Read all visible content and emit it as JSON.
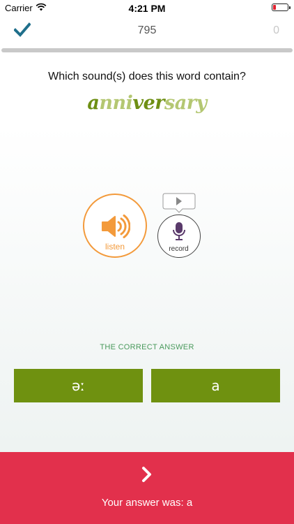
{
  "status_bar": {
    "carrier": "Carrier",
    "time": "4:21 PM",
    "battery_color": "#e0212f"
  },
  "header": {
    "score": "795",
    "count": "0"
  },
  "question": "Which sound(s) does this word contain?",
  "word": {
    "segments": [
      {
        "text": "a",
        "highlight": true
      },
      {
        "text": "nni",
        "highlight": false
      },
      {
        "text": "ver",
        "highlight": true
      },
      {
        "text": "sary",
        "highlight": false
      }
    ]
  },
  "listen": {
    "label": "listen",
    "icon": "speaker-icon",
    "color": "#f39a3b"
  },
  "record": {
    "label": "record",
    "icon": "mic-icon",
    "bubble_icon": "play-icon"
  },
  "correct_answer": {
    "label": "THE CORRECT ANSWER",
    "options": [
      "əː",
      "a"
    ],
    "color": "#6f9110"
  },
  "bottom": {
    "next_icon": "chevron-right-icon",
    "your_answer": "Your answer was: a",
    "color": "#e2304c"
  }
}
